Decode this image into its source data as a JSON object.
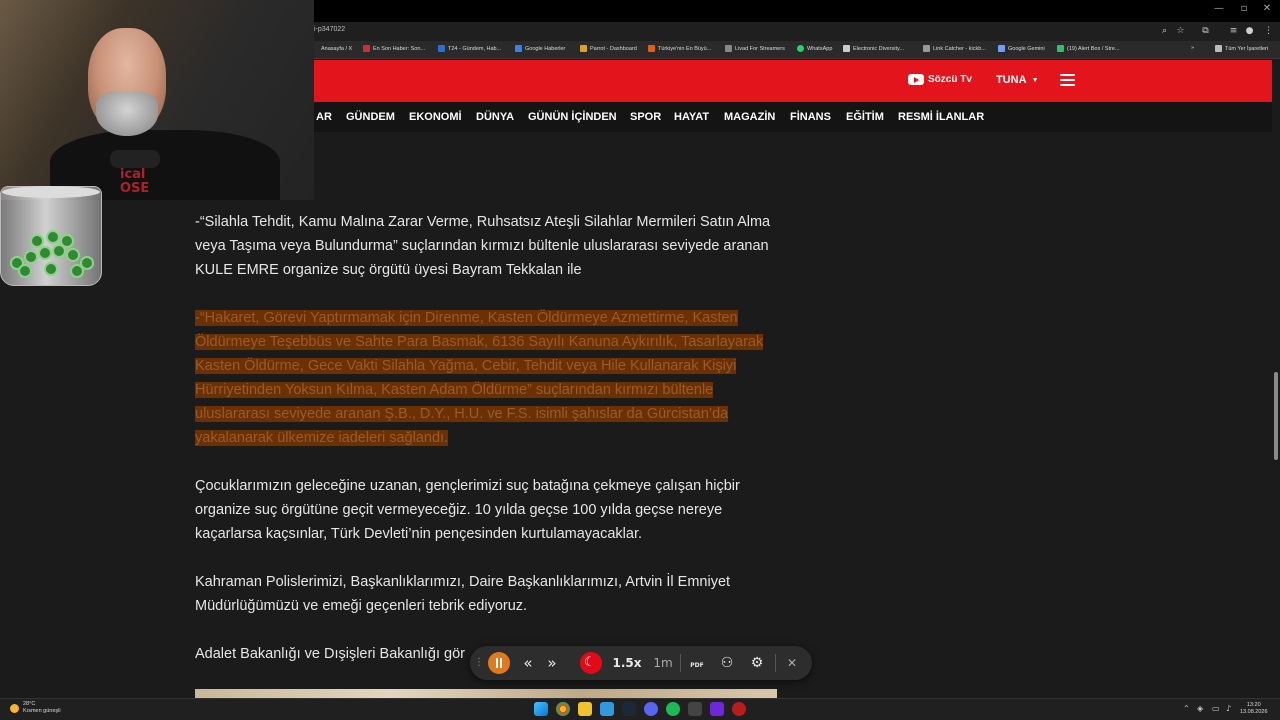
{
  "browser": {
    "url": "i-p347022",
    "window_controls": [
      "—",
      "▫",
      "✕"
    ],
    "bookmarks": [
      {
        "label": "Anasayfa / X",
        "color": "#444444"
      },
      {
        "label": "En Son Haber: Son...",
        "color": "#d62b2b"
      },
      {
        "label": "T24 - Gündem, Hab...",
        "color": "#2b6fd6"
      },
      {
        "label": "Google Haberler",
        "color": "#3b7ef0"
      },
      {
        "label": "Parrot - Dashboard",
        "color": "#e0a020"
      },
      {
        "label": "Türkiye'nin En Büyü...",
        "color": "#e06010"
      },
      {
        "label": "Livad For Streamers",
        "color": "#888888"
      },
      {
        "label": "WhatsApp",
        "color": "#25d366"
      },
      {
        "label": "Electronic Diversity...",
        "color": "#cccccc"
      },
      {
        "label": "Link Catcher - kickb...",
        "color": "#999999"
      },
      {
        "label": "Google Gemini",
        "color": "#6aa0ff"
      },
      {
        "label": "(19) Alert Box / Stre...",
        "color": "#2fbf71"
      },
      {
        "label": "Tüm Yer İşaretleri",
        "color": "#bbbbbb"
      }
    ],
    "overflow_label": "»"
  },
  "site": {
    "header_color": "#e3141c",
    "sozcu_tv_label": "Sözcü Tv",
    "user_label": "TUNA",
    "nav": [
      "AR",
      "GÜNDEM",
      "EKONOMİ",
      "DÜNYA",
      "GÜNÜN İÇİNDEN",
      "SPOR",
      "HAYAT",
      "MAGAZİN",
      "FİNANS",
      "EĞİTİM",
      "RESMİ İLANLAR"
    ]
  },
  "article": {
    "p1": "-“Silahla Tehdit, Kamu Malına Zarar Verme, Ruhsatsız Ateşli Silahlar Mermileri Satın Alma veya Taşıma veya Bulundurma” suçlarından kırmızı bültenle uluslararası seviyede aranan KULE EMRE organize suç örgütü üyesi Bayram Tekkalan ile",
    "p2": "-“Hakaret, Görevi Yaptırmamak için Direnme, Kasten Öldürmeye Azmettirme, Kasten Öldürmeye Teşebbüs ve Sahte Para Basmak, 6136 Sayılı Kanuna Aykırılık, Tasarlayarak Kasten Öldürme, Gece Vakti Silahla Yağma, Cebir, Tehdit veya Hile Kullanarak Kişiyi Hürriyetinden Yoksun Kılma, Kasten Adam Öldürme” suçlarından kırmızı bültenle uluslararası seviyede aranan Ş.B., D.Y., H.U. ve F.S. isimli şahıslar da Gürcistan’da yakalanarak ülkemize iadeleri sağlandı.",
    "p3": "Çocuklarımızın geleceğine uzanan, gençlerimizi suç batağına çekmeye çalışan hiçbir organize suç örgütüne geçit vermeyeceğiz. 10 yılda geçse 100 yılda geçse nereye kaçarlarsa kaçsınlar, Türk Devleti’nin pençesinden kurtulamayacaklar.",
    "p4": "Kahraman Polislerimizi, Başkanlıklarımızı, Daire Başkanlıklarımızı, Artvin İl Emniyet Müdürlüğümüzü ve emeği geçenleri tebrik ediyoruz.",
    "p5": "Adalet Bakanlığı ve Dışişleri Bakanlığı gör"
  },
  "webcam": {
    "shirt_text": "ical\nOSE"
  },
  "reader_toolbar": {
    "rewind": "«",
    "forward": "»",
    "speed": "1.5x",
    "time": "1m",
    "pdf": "PDF",
    "close": "✕",
    "accent_color": "#e07a1f"
  },
  "taskbar": {
    "weather_temp": "28°C",
    "weather_desc": "Kısmen güneşli",
    "time": "13:20",
    "date": "13.08.2026"
  }
}
